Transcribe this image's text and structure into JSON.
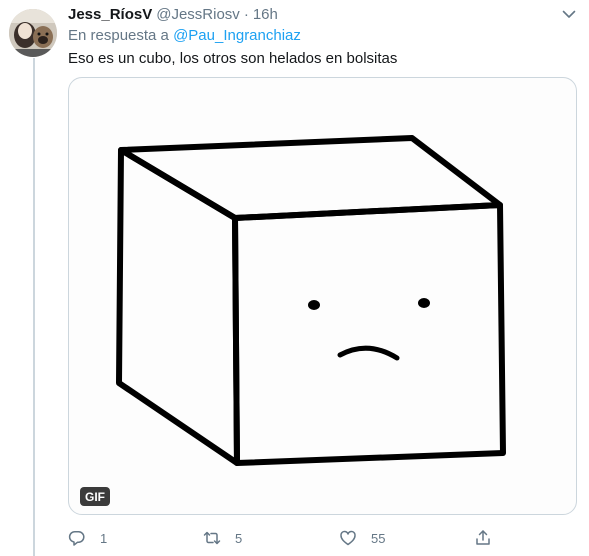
{
  "tweet": {
    "author": {
      "display_name": "Jess_RíosV",
      "handle": "@JessRiosv",
      "separator": "·",
      "time": "16h",
      "avatar_icon": "avatar-photo"
    },
    "reply_context": {
      "prefix": "En respuesta a",
      "mention": "@Pau_Ingranchiaz"
    },
    "text": "Eso es un cubo, los otros son helados en bolsitas",
    "media": {
      "type": "gif",
      "badge": "GIF",
      "icon": "sad-cube-drawing"
    },
    "actions": {
      "reply": {
        "icon": "reply-icon",
        "count": "1"
      },
      "retweet": {
        "icon": "retweet-icon",
        "count": "5"
      },
      "like": {
        "icon": "heart-icon",
        "count": "55"
      },
      "share": {
        "icon": "share-icon"
      }
    },
    "more_icon": "chevron-down-icon"
  },
  "colors": {
    "secondary_text": "#657786",
    "link": "#1da1f2",
    "border": "#ccd6dd"
  }
}
